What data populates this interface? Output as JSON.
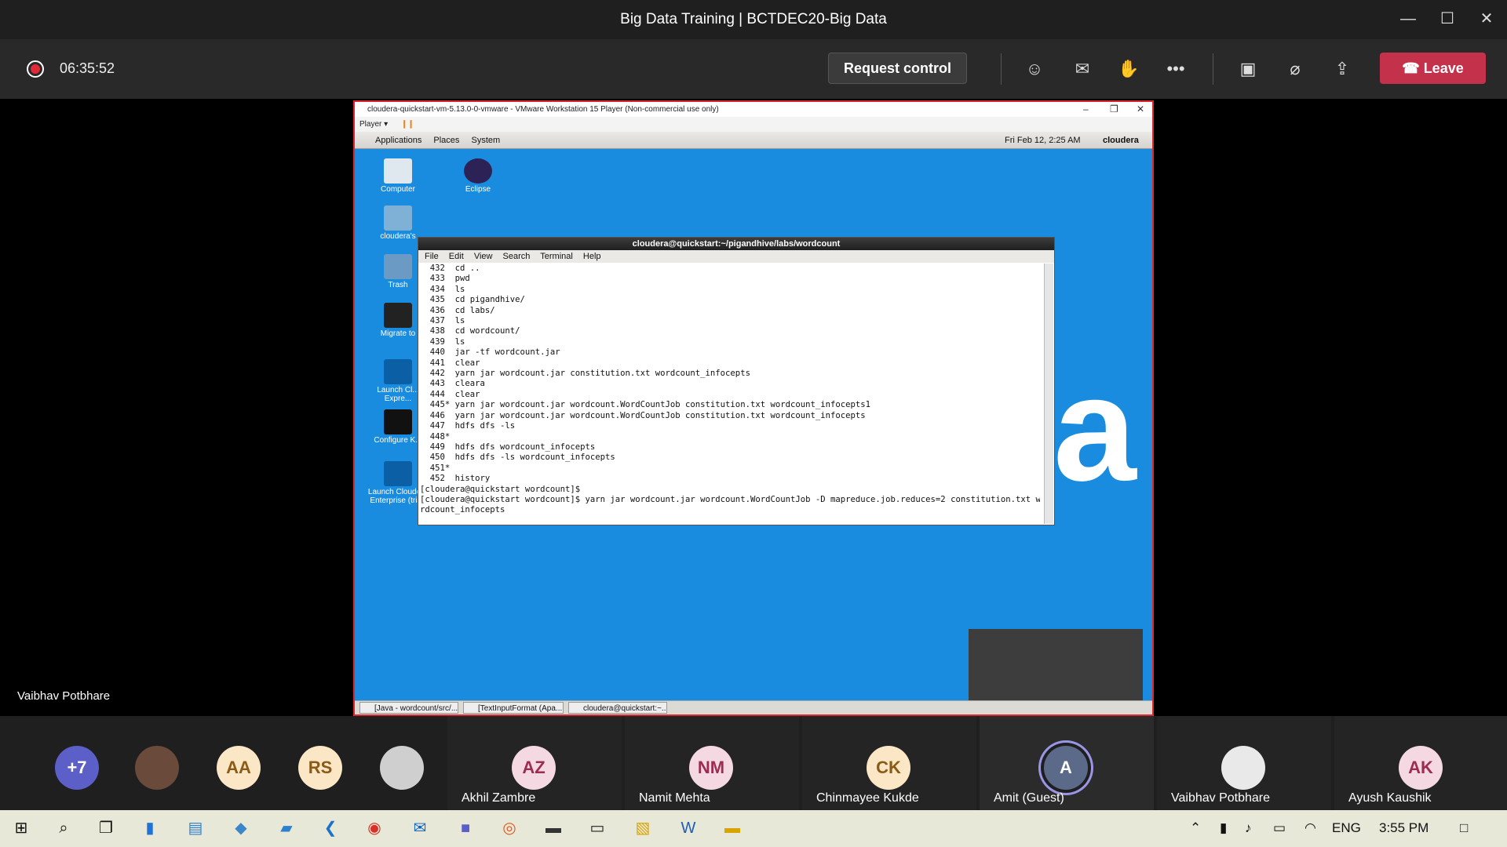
{
  "window": {
    "title": "Big Data Training | BCTDEC20-Big Data"
  },
  "meeting": {
    "timer": "06:35:52",
    "request_control_label": "Request control",
    "leave_label": "Leave",
    "presenter_name": "Vaibhav Potbhare"
  },
  "vm": {
    "title": "cloudera-quickstart-vm-5.13.0-0-vmware - VMware Workstation 15 Player (Non-commercial use only)",
    "player_label": "Player",
    "panel": {
      "applications": "Applications",
      "places": "Places",
      "system": "System",
      "clock": "Fri Feb 12,  2:25 AM",
      "user": "cloudera"
    },
    "desktop_icons": [
      "Computer",
      "Eclipse",
      "cloudera's",
      "Trash",
      "Migrate to",
      "Launch Cl... Expre...",
      "Configure K...",
      "Launch Cloudera Enterprise (trial)"
    ],
    "taskbar": [
      "[Java - wordcount/src/...",
      "[TextInputFormat (Apa...",
      "cloudera@quickstart:~..."
    ]
  },
  "terminal": {
    "title": "cloudera@quickstart:~/pigandhive/labs/wordcount",
    "menu": [
      "File",
      "Edit",
      "View",
      "Search",
      "Terminal",
      "Help"
    ],
    "lines": [
      "  432  cd ..",
      "  433  pwd",
      "  434  ls",
      "  435  cd pigandhive/",
      "  436  cd labs/",
      "  437  ls",
      "  438  cd wordcount/",
      "  439  ls",
      "  440  jar -tf wordcount.jar",
      "  441  clear",
      "  442  yarn jar wordcount.jar constitution.txt wordcount_infocepts",
      "  443  cleara",
      "  444  clear",
      "  445* yarn jar wordcount.jar wordcount.WordCountJob constitution.txt wordcount_infocepts1",
      "  446  yarn jar wordcount.jar wordcount.WordCountJob constitution.txt wordcount_infocepts",
      "  447  hdfs dfs -ls",
      "  448*",
      "  449  hdfs dfs wordcount_infocepts",
      "  450  hdfs dfs -ls wordcount_infocepts",
      "  451*",
      "  452  history",
      "[cloudera@quickstart wordcount]$",
      "[cloudera@quickstart wordcount]$ yarn jar wordcount.jar wordcount.WordCountJob -D mapreduce.job.reduces=2 constitution.txt wo",
      "rdcount_infocepts"
    ]
  },
  "participants": [
    {
      "initials": "+7",
      "name": "",
      "bg": "#5b5fc7",
      "fg": "#ffffff"
    },
    {
      "initials": "",
      "name": "",
      "bg": "#6a4a3a",
      "fg": "#ffffff"
    },
    {
      "initials": "AA",
      "name": "",
      "bg": "#fbe6c5",
      "fg": "#8a5a17"
    },
    {
      "initials": "RS",
      "name": "",
      "bg": "#fbe6c5",
      "fg": "#8a5a17"
    },
    {
      "initials": "",
      "name": "",
      "bg": "#cfcfcf",
      "fg": "#ffffff"
    },
    {
      "initials": "AZ",
      "name": "Akhil Zambre",
      "bg": "#f5d9e2",
      "fg": "#9b2c52"
    },
    {
      "initials": "NM",
      "name": "Namit Mehta",
      "bg": "#f5d9e2",
      "fg": "#9b2c52"
    },
    {
      "initials": "CK",
      "name": "Chinmayee Kukde",
      "bg": "#fbe6c5",
      "fg": "#8a5a17"
    },
    {
      "initials": "A",
      "name": "Amit (Guest)",
      "bg": "#5c6a8a",
      "fg": "#ffffff"
    },
    {
      "initials": "",
      "name": "Vaibhav Potbhare",
      "bg": "#e9e9e9",
      "fg": "#ffffff"
    },
    {
      "initials": "AK",
      "name": "Ayush Kaushik",
      "bg": "#f5d9e2",
      "fg": "#9b2c52"
    }
  ],
  "taskbar": {
    "lang": "ENG",
    "time": "3:55 PM"
  },
  "colors": {
    "leave": "#c4314b",
    "recording": "#e12b38",
    "desktop": "#1a8ce0",
    "vm_border": "#d9262f"
  }
}
